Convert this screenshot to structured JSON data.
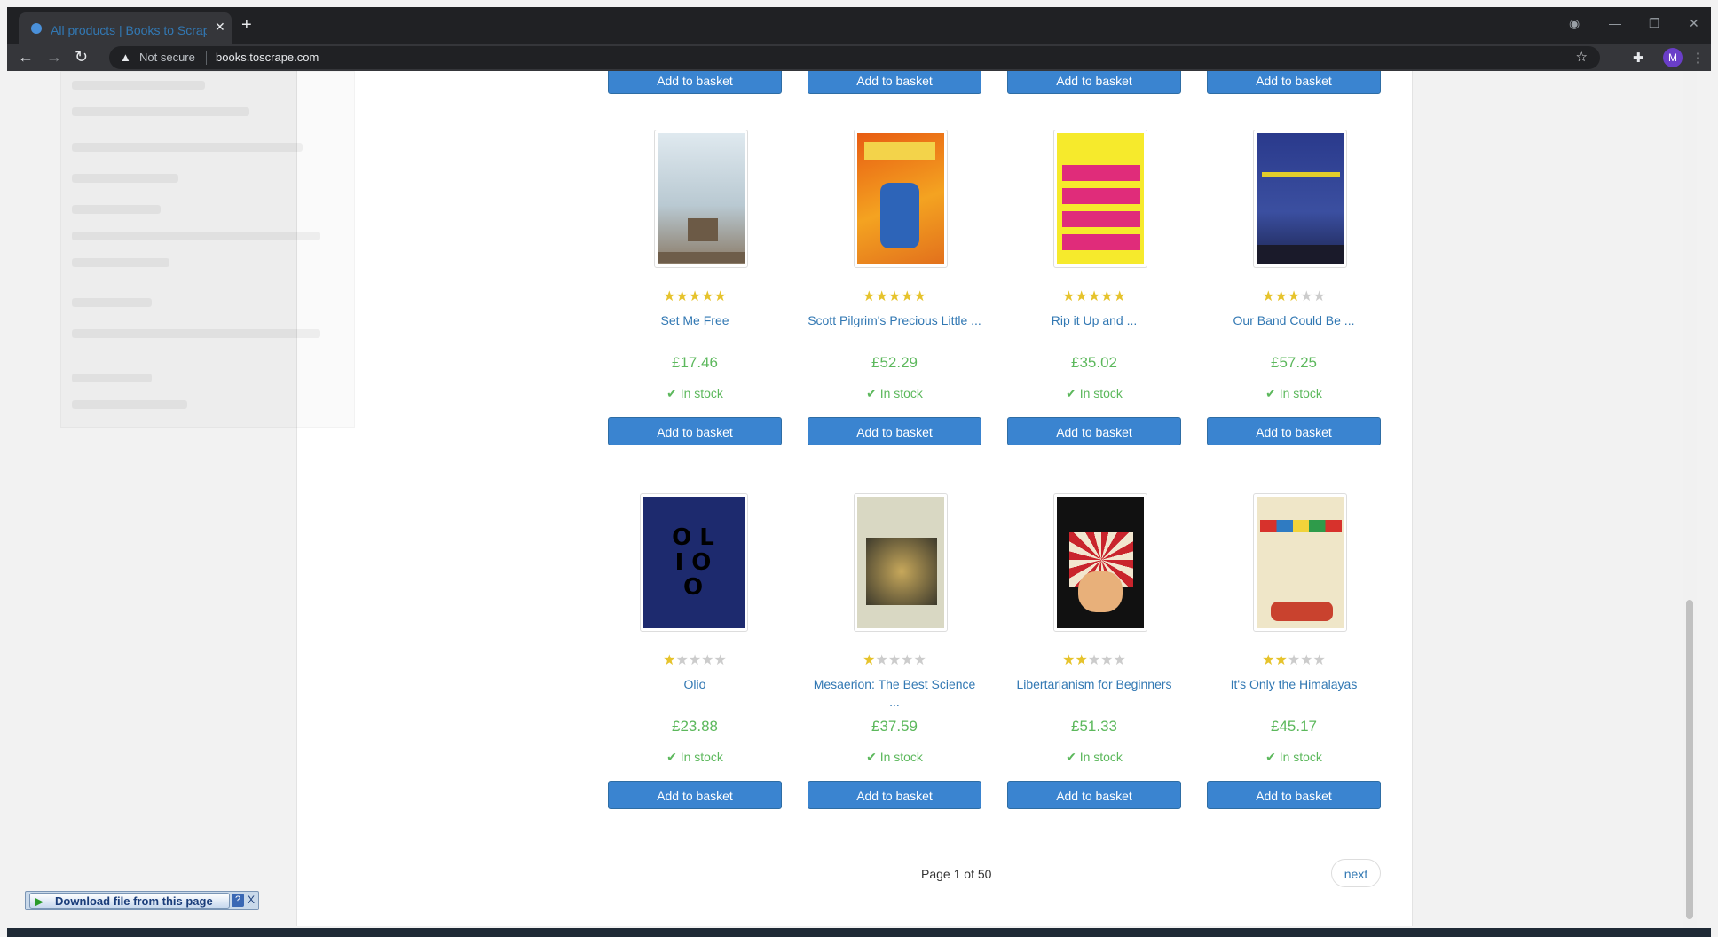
{
  "browser": {
    "tab_title": "All products | Books to Scrape - Sandbox",
    "tab_close": "✕",
    "new_tab": "+",
    "security_text": "Not secure",
    "url": "books.toscrape.com",
    "profile_initial": "M"
  },
  "products": [
    {
      "title": "Set Me Free",
      "rating": 5,
      "price": "£17.46",
      "stock": "In stock",
      "button": "Add to basket"
    },
    {
      "title": "Scott Pilgrim's Precious Little ...",
      "rating": 5,
      "price": "£52.29",
      "stock": "In stock",
      "button": "Add to basket"
    },
    {
      "title": "Rip it Up and ...",
      "rating": 5,
      "price": "£35.02",
      "stock": "In stock",
      "button": "Add to basket"
    },
    {
      "title": "Our Band Could Be ...",
      "rating": 3,
      "price": "£57.25",
      "stock": "In stock",
      "button": "Add to basket"
    },
    {
      "title": "Olio",
      "rating": 1,
      "price": "£23.88",
      "stock": "In stock",
      "button": "Add to basket"
    },
    {
      "title": "Mesaerion: The Best Science ...",
      "rating": 1,
      "price": "£37.59",
      "stock": "In stock",
      "button": "Add to basket"
    },
    {
      "title": "Libertarianism for Beginners",
      "rating": 2,
      "price": "£51.33",
      "stock": "In stock",
      "button": "Add to basket"
    },
    {
      "title": "It's Only the Himalayas",
      "rating": 2,
      "price": "£45.17",
      "stock": "In stock",
      "button": "Add to basket"
    }
  ],
  "prev_row_button": "Add to basket",
  "pager": {
    "text": "Page 1 of 50",
    "next": "next"
  },
  "download_bar": {
    "label": "Download file from this page",
    "help": "?",
    "close": "X"
  }
}
